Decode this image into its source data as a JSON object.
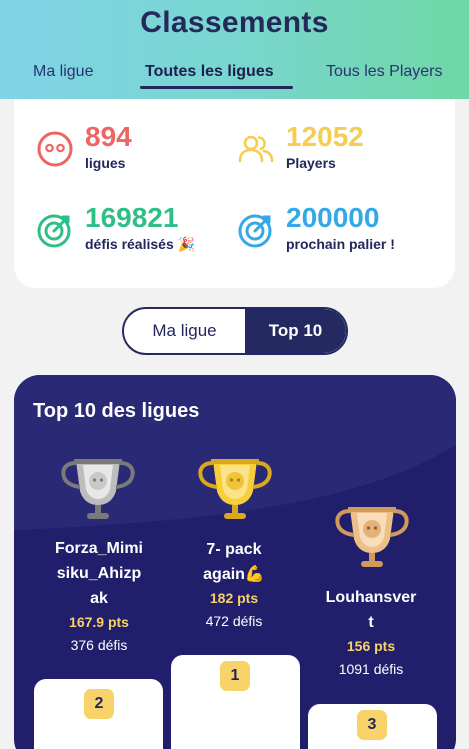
{
  "header": {
    "title": "Classements",
    "tabs": [
      {
        "label": "Ma ligue",
        "active": false
      },
      {
        "label": "Toutes les ligues",
        "active": true
      },
      {
        "label": "Tous les Players",
        "active": false
      }
    ]
  },
  "stats": [
    {
      "value": "894",
      "label": "ligues",
      "color": "#ee6461",
      "icon": "face-icon"
    },
    {
      "value": "12052",
      "label": "Players",
      "color": "#f6cc51",
      "icon": "users-icon"
    },
    {
      "value": "169821",
      "label": "défis réalisés 🎉",
      "color": "#2fbf86",
      "icon": "target-icon"
    },
    {
      "value": "200000",
      "label": "prochain palier !",
      "color": "#35a8e8",
      "icon": "target-icon"
    }
  ],
  "toggle": {
    "left": "Ma ligue",
    "right": "Top 10"
  },
  "top10": {
    "title": "Top 10 des ligues",
    "entries": [
      {
        "rank": "2",
        "name": "Forza_Mimisiku_Ahizpak",
        "name_lines": [
          "Forza_Mimi",
          "siku_Ahizp",
          "ak"
        ],
        "points": "167.9 pts",
        "defis": "376 défis",
        "trophy": "silver"
      },
      {
        "rank": "1",
        "name": "7- pack again💪",
        "name_lines": [
          "7- pack",
          "again💪"
        ],
        "points": "182 pts",
        "defis": "472 défis",
        "trophy": "gold"
      },
      {
        "rank": "3",
        "name": "Louhansvert",
        "name_lines": [
          "Louhansver",
          "t"
        ],
        "points": "156 pts",
        "defis": "1091 défis",
        "trophy": "bronze"
      }
    ]
  },
  "colors": {
    "header_start": "#7fd3e6",
    "header_end": "#6fd7a5",
    "navy": "#252962",
    "card_bg": "#211f6b",
    "rank_badge": "#f7d36a",
    "points": "#f7d264"
  }
}
